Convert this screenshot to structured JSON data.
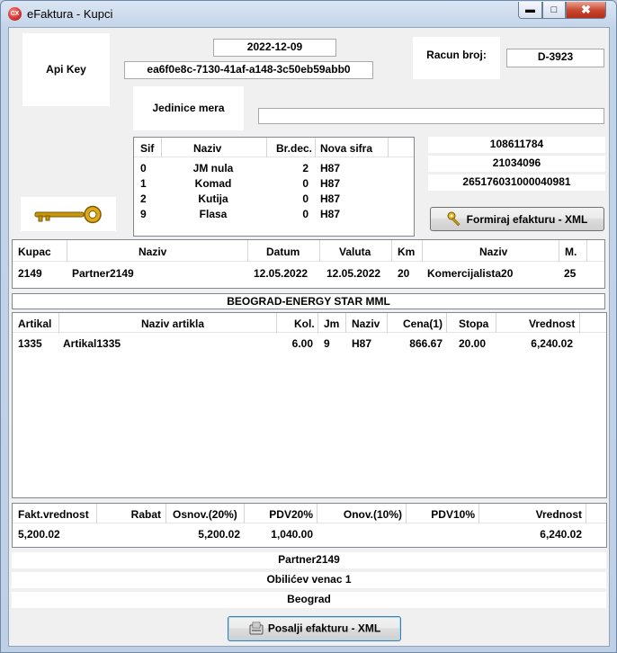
{
  "window": {
    "title": "eFaktura - Kupci",
    "icon_text": "CX"
  },
  "header": {
    "api_key_label": "Api Key",
    "date": "2022-12-09",
    "api_key_value": "ea6f0e8c-7130-41af-a148-3c50eb59abb0",
    "racun_label": "Racun broj:",
    "racun_value": "D-3923",
    "jedinice_label": "Jedinice mera",
    "jedinice_value": ""
  },
  "units_table": {
    "columns": [
      "Sif",
      "Naziv",
      "Br.dec.",
      "Nova sifra"
    ],
    "rows": [
      [
        "0",
        "JM nula",
        "2",
        "H87"
      ],
      [
        "1",
        "Komad",
        "0",
        "H87"
      ],
      [
        "2",
        "Kutija",
        "0",
        "H87"
      ],
      [
        "9",
        "Flasa",
        "0",
        "H87"
      ]
    ]
  },
  "ids": [
    "108611784",
    "21034096",
    "265176031000040981"
  ],
  "formiraj_button": "Formiraj efakturu - XML",
  "customer_table": {
    "columns": [
      "Kupac",
      "Naziv",
      "Datum",
      "Valuta",
      "Km",
      "Naziv",
      "M."
    ],
    "rows": [
      [
        "2149",
        "Partner2149",
        "12.05.2022",
        "12.05.2022",
        "20",
        "Komercijalista20",
        "25"
      ]
    ]
  },
  "location_bar": "BEOGRAD-ENERGY STAR MML",
  "article_table": {
    "columns": [
      "Artikal",
      "Naziv artikla",
      "Kol.",
      "Jm",
      "Naziv",
      "Cena(1)",
      "Stopa",
      "Vrednost"
    ],
    "rows": [
      [
        "1335",
        "Artikal1335",
        "6.00",
        "9",
        "H87",
        "866.67",
        "20.00",
        "6,240.02"
      ]
    ]
  },
  "totals_table": {
    "columns": [
      "Fakt.vrednost",
      "Rabat",
      "Osnov.(20%)",
      "PDV20%",
      "Onov.(10%)",
      "PDV10%",
      "Vrednost"
    ],
    "rows": [
      [
        "5,200.02",
        "",
        "5,200.02",
        "1,040.00",
        "",
        "",
        "6,240.02"
      ]
    ]
  },
  "footer": {
    "partner": "Partner2149",
    "address": "Obilićev venac 1",
    "city": "Beograd"
  },
  "posalji_button": "Posalji efakturu - XML"
}
